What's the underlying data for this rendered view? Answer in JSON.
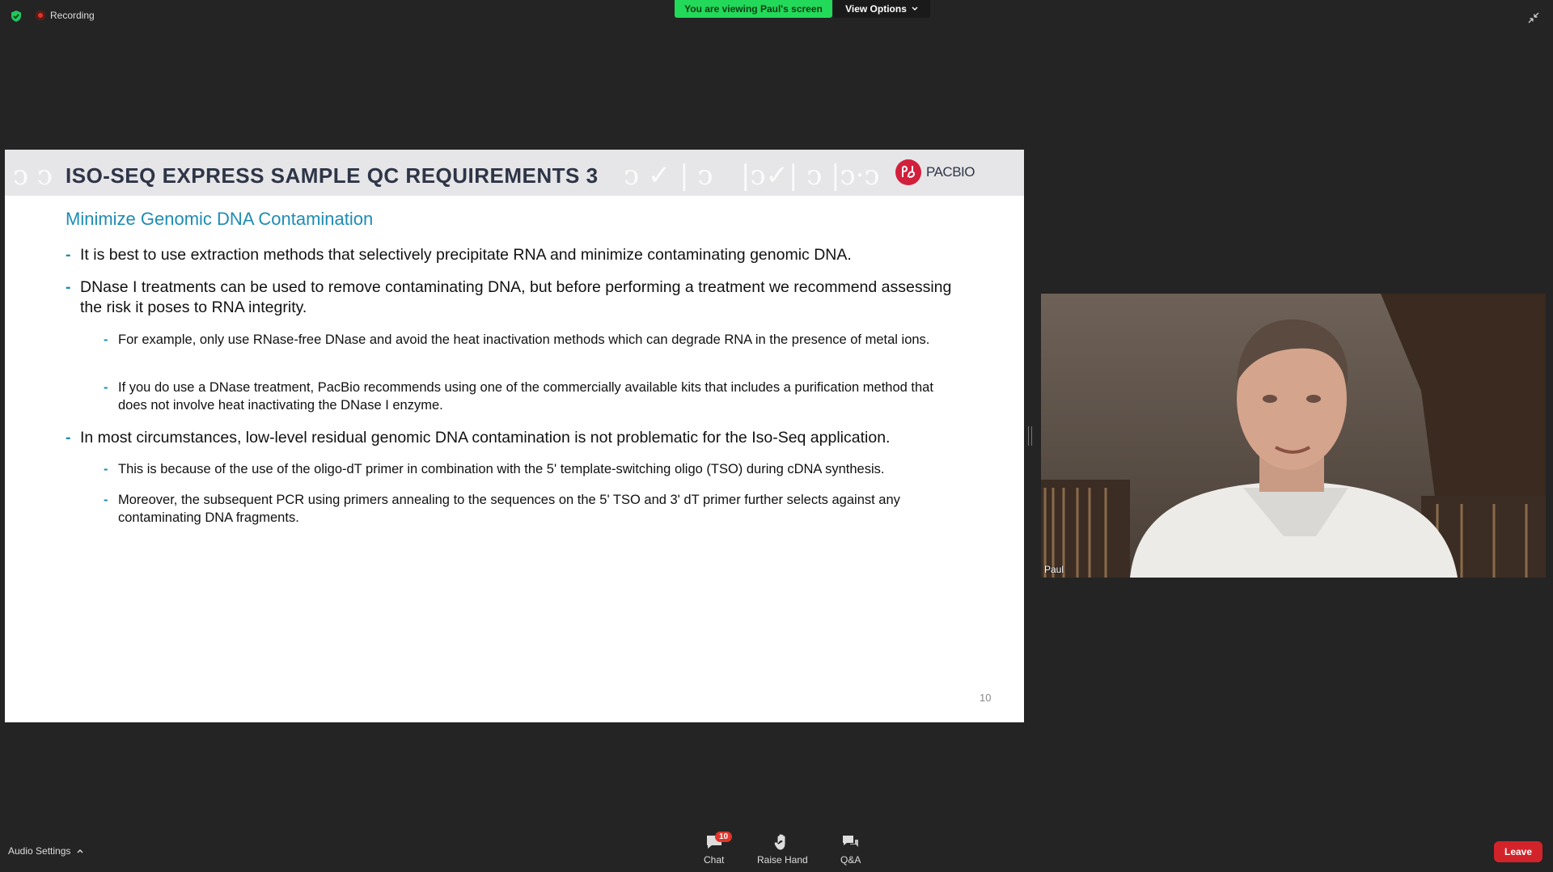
{
  "top_bar": {
    "recording_label": "Recording",
    "viewing_banner": "You are viewing Paul's screen",
    "view_options_label": "View Options"
  },
  "slide": {
    "title": "ISO-SEQ EXPRESS SAMPLE QC REQUIREMENTS 3",
    "logo_text": "PACBIO",
    "subtitle": "Minimize Genomic DNA Contamination",
    "bullets": [
      "It is best to use extraction methods that selectively precipitate RNA and minimize contaminating genomic DNA.",
      "DNase I treatments can be used to remove contaminating DNA, but before performing a treatment we recommend assessing the risk it poses to RNA integrity.",
      "In most circumstances, low-level residual genomic DNA contamination is not problematic for the Iso-Seq application."
    ],
    "sub_bullets_1": [
      "For example, only use RNase-free DNase and avoid the heat inactivation methods which can degrade RNA in the presence of metal ions.",
      "If you do use a DNase treatment, PacBio recommends using one of the commercially available kits that includes a purification method that does not involve heat inactivating the DNase I enzyme."
    ],
    "sub_bullets_2": [
      "This is because of the use of the oligo-dT primer in combination with the 5' template-switching oligo (TSO) during cDNA synthesis.",
      "Moreover, the subsequent PCR using primers annealing to the sequences on the 5' TSO and 3' dT primer further selects against any contaminating DNA fragments."
    ],
    "bullet_dash": "-",
    "page_number": "10"
  },
  "video": {
    "participant_name": "Paul"
  },
  "bottom_bar": {
    "audio_settings_label": "Audio Settings",
    "chat_label": "Chat",
    "chat_badge": "10",
    "raise_hand_label": "Raise Hand",
    "qa_label": "Q&A",
    "leave_label": "Leave"
  },
  "colors": {
    "background": "#242424",
    "banner_green": "#23d959",
    "slide_accent": "#1e8cb4",
    "title_color": "#2e3547",
    "leave_red": "#d3232a"
  },
  "icons": [
    "shield-icon",
    "record-icon",
    "chevron-down-icon",
    "exit-fullscreen-icon",
    "chat-icon",
    "hand-icon",
    "qa-icon",
    "chevron-up-icon"
  ]
}
